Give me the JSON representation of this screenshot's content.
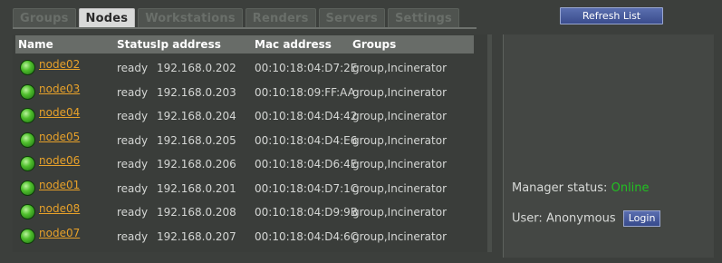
{
  "tabs": [
    {
      "label": "Groups",
      "active": false
    },
    {
      "label": "Nodes",
      "active": true
    },
    {
      "label": "Workstations",
      "active": false
    },
    {
      "label": "Renders",
      "active": false
    },
    {
      "label": "Servers",
      "active": false
    },
    {
      "label": "Settings",
      "active": false
    }
  ],
  "toolbar": {
    "refresh_label": "Refresh List"
  },
  "table": {
    "headers": {
      "name": "Name",
      "status": "Status",
      "ip": "Ip address",
      "mac": "Mac address",
      "groups": "Groups"
    },
    "rows": [
      {
        "name": "node02",
        "status": "ready",
        "ip": "192.168.0.202",
        "mac": "00:10:18:04:D7:2E",
        "groups": "group,Incinerator"
      },
      {
        "name": "node03",
        "status": "ready",
        "ip": "192.168.0.203",
        "mac": "00:10:18:09:FF:AA",
        "groups": "group,Incinerator"
      },
      {
        "name": "node04",
        "status": "ready",
        "ip": "192.168.0.204",
        "mac": "00:10:18:04:D4:42",
        "groups": "group,Incinerator"
      },
      {
        "name": "node05",
        "status": "ready",
        "ip": "192.168.0.205",
        "mac": "00:10:18:04:D4:E6",
        "groups": "group,Incinerator"
      },
      {
        "name": "node06",
        "status": "ready",
        "ip": "192.168.0.206",
        "mac": "00:10:18:04:D6:4E",
        "groups": "group,Incinerator"
      },
      {
        "name": "node01",
        "status": "ready",
        "ip": "192.168.0.201",
        "mac": "00:10:18:04:D7:1C",
        "groups": "group,Incinerator"
      },
      {
        "name": "node08",
        "status": "ready",
        "ip": "192.168.0.208",
        "mac": "00:10:18:04:D9:9B",
        "groups": "group,Incinerator"
      },
      {
        "name": "node07",
        "status": "ready",
        "ip": "192.168.0.207",
        "mac": "00:10:18:04:D4:6C",
        "groups": "group,Incinerator"
      }
    ]
  },
  "status_panel": {
    "manager_label": "Manager status:",
    "manager_value": "Online",
    "user_label": "User:",
    "user_value": "Anonymous",
    "login_label": "Login"
  },
  "icons": {
    "node_status": "node-online-icon"
  },
  "colors": {
    "online": "#21c021",
    "link": "#e7a12a",
    "accent_button": "#3a4c8c"
  }
}
